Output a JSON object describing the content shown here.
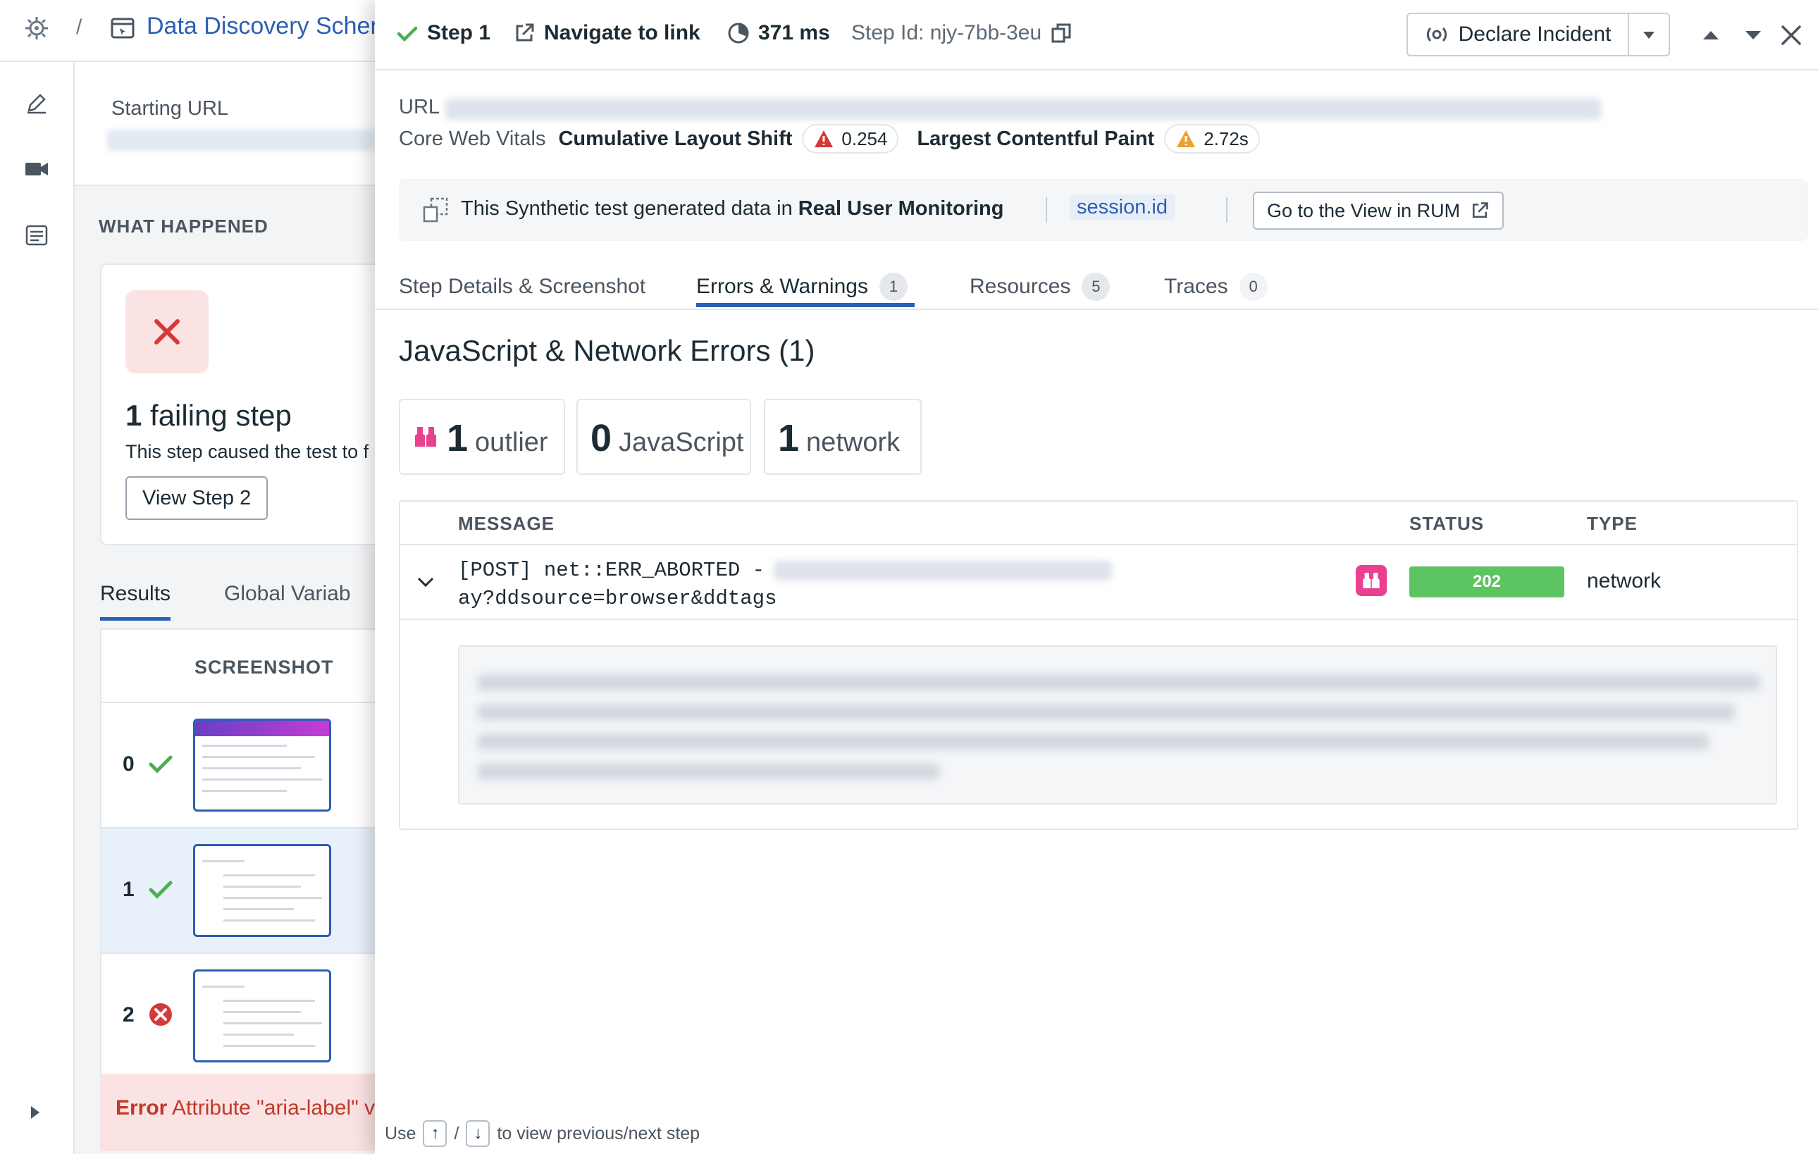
{
  "breadcrumb": {
    "separator": "/",
    "title": "Data Discovery Scher"
  },
  "left_rail": {
    "icons": [
      "edit-icon",
      "video-icon",
      "list-icon"
    ]
  },
  "left_page": {
    "starting_url_label": "Starting URL",
    "what_happened_label": "WHAT HAPPENED",
    "failing_count": "1",
    "failing_text": "failing step",
    "failing_desc": "This step caused the test to f",
    "view_step_label": "View Step 2",
    "tabs": [
      {
        "label": "Results",
        "active": true
      },
      {
        "label": "Global Variab",
        "active": false
      }
    ],
    "results_header": "SCREENSHOT",
    "rows": [
      {
        "num": "0",
        "status": "pass"
      },
      {
        "num": "1",
        "status": "pass"
      },
      {
        "num": "2",
        "status": "fail"
      }
    ],
    "error_label": "Error",
    "error_text": "Attribute \"aria-label\" v"
  },
  "panel": {
    "step_label": "Step 1",
    "action_label": "Navigate to link",
    "duration": "371 ms",
    "step_id": "Step Id: njy-7bb-3eu",
    "declare_incident": "Declare Incident",
    "url_label": "URL",
    "cwv": {
      "label": "Core Web Vitals",
      "cls_label": "Cumulative Layout Shift",
      "cls_value": "0.254",
      "lcp_label": "Largest Contentful Paint",
      "lcp_value": "2.72s"
    },
    "rum": {
      "text_prefix": "This Synthetic test generated data in",
      "text_bold": "Real User Monitoring",
      "session": "session.id",
      "button": "Go to the View in RUM"
    },
    "tabs": [
      {
        "label": "Step Details & Screenshot",
        "count": ""
      },
      {
        "label": "Errors & Warnings",
        "count": "1"
      },
      {
        "label": "Resources",
        "count": "5"
      },
      {
        "label": "Traces",
        "count": "0"
      }
    ],
    "section_title": "JavaScript & Network Errors (1)",
    "summary": [
      {
        "num": "1",
        "label": "outlier"
      },
      {
        "num": "0",
        "label": "JavaScript"
      },
      {
        "num": "1",
        "label": "network"
      }
    ],
    "table": {
      "headers": {
        "message": "MESSAGE",
        "status": "STATUS",
        "type": "TYPE"
      },
      "row": {
        "message_line1": "[POST] net::ERR_ABORTED -",
        "message_line2": "ay?ddsource=browser&ddtags",
        "status": "202",
        "type": "network"
      }
    },
    "footer": {
      "use": "Use",
      "up": "↑",
      "slash": "/",
      "down": "↓",
      "rest": "to view previous/next step"
    }
  },
  "colors": {
    "accent": "#2b5fb4",
    "success": "#5cc461",
    "error": "#d33a3a",
    "warning": "#f0a030",
    "outlier": "#e8418f"
  }
}
